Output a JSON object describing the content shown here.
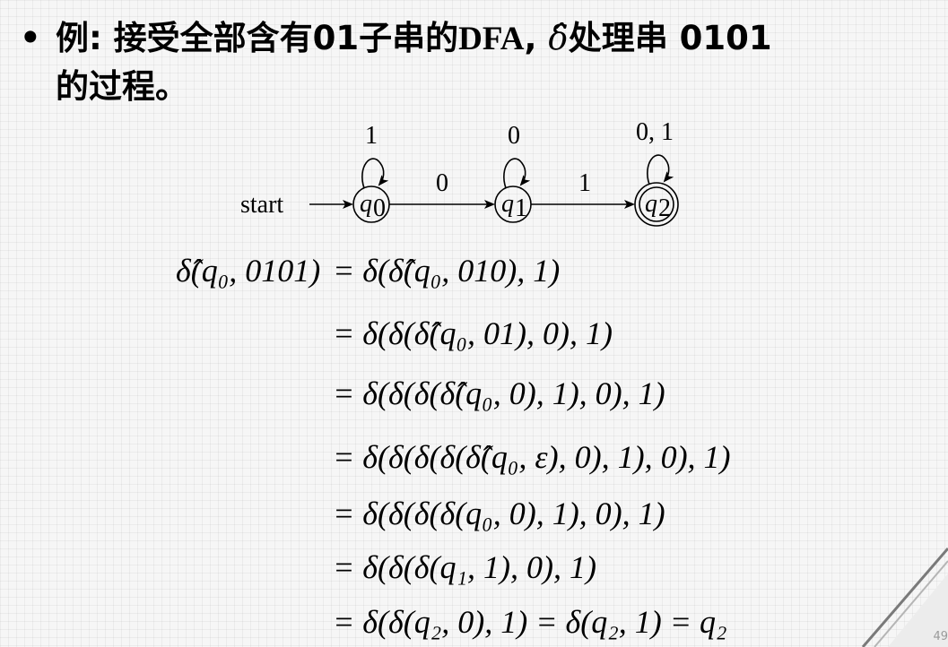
{
  "slide": {
    "bullet": "•",
    "title_line1_prefix": "例: 接受全部含有01子串的",
    "title_line1_dfa": "DFA",
    "title_line1_comma": ",",
    "title_line1_delta": "δ̂",
    "title_line1_suffix": "处理串 0101",
    "title_line2": "的过程。",
    "page_number": "49"
  },
  "dfa": {
    "start_label": "start",
    "states": [
      {
        "label": "q",
        "sub": "0",
        "accepting": false,
        "self_loop": "1"
      },
      {
        "label": "q",
        "sub": "1",
        "accepting": false,
        "self_loop": "0"
      },
      {
        "label": "q",
        "sub": "2",
        "accepting": true,
        "self_loop": "0, 1"
      }
    ],
    "transitions": [
      {
        "from": "q0",
        "to": "q1",
        "label": "0"
      },
      {
        "from": "q1",
        "to": "q2",
        "label": "1"
      }
    ]
  },
  "derivation": {
    "lhs": "δ̂(q₀, 0101)",
    "steps": [
      "= δ(δ̂(q₀, 010), 1)",
      "= δ(δ(δ̂(q₀, 01), 0), 1)",
      "= δ(δ(δ(δ̂(q₀, 0), 1), 0), 1)",
      "= δ(δ(δ(δ(δ̂(q₀, ε), 0), 1), 0), 1)",
      "= δ(δ(δ(δ(q₀, 0), 1), 0), 1)",
      "= δ(δ(δ(q₁, 1), 0), 1)",
      "= δ(δ(q₂, 0), 1) = δ(q₂, 1) = q₂"
    ]
  }
}
